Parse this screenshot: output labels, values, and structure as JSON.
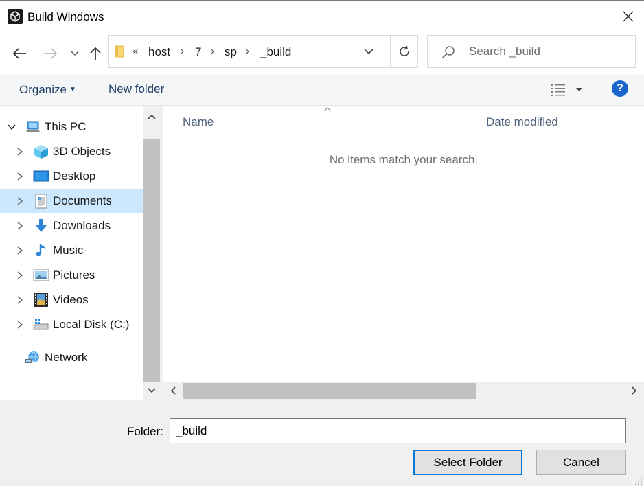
{
  "window": {
    "title": "Build Windows",
    "icon": "unity-icon",
    "close_icon": "close-icon"
  },
  "nav": {
    "back_icon": "arrow-left-icon",
    "forward_icon": "arrow-right-icon",
    "recent_icon": "chevron-down-icon",
    "up_icon": "arrow-up-icon",
    "refresh_icon": "refresh-icon"
  },
  "address": {
    "overflow": "«",
    "crumbs": [
      "host",
      "7",
      "sp",
      "_build"
    ]
  },
  "search": {
    "placeholder": "Search _build",
    "value": ""
  },
  "toolbar": {
    "organize_label": "Organize",
    "new_folder_label": "New folder",
    "help_label": "?"
  },
  "sidebar": {
    "items": [
      {
        "label": "This PC",
        "icon": "computer-icon",
        "expanded": true
      },
      {
        "label": "3D Objects",
        "icon": "cube-icon"
      },
      {
        "label": "Desktop",
        "icon": "desktop-icon"
      },
      {
        "label": "Documents",
        "icon": "document-icon",
        "selected": true
      },
      {
        "label": "Downloads",
        "icon": "download-icon"
      },
      {
        "label": "Music",
        "icon": "music-note-icon"
      },
      {
        "label": "Pictures",
        "icon": "picture-icon"
      },
      {
        "label": "Videos",
        "icon": "film-icon"
      },
      {
        "label": "Local Disk (C:)",
        "icon": "disk-icon"
      },
      {
        "label": "Network",
        "icon": "network-icon"
      }
    ]
  },
  "content": {
    "columns": [
      "Name",
      "Date modified"
    ],
    "empty_message": "No items match your search."
  },
  "footer": {
    "folder_label": "Folder:",
    "folder_value": "_build",
    "select_label": "Select Folder",
    "cancel_label": "Cancel"
  },
  "colors": {
    "accent": "#0078d7",
    "selection": "#cce8ff",
    "help": "#1a66cc"
  }
}
